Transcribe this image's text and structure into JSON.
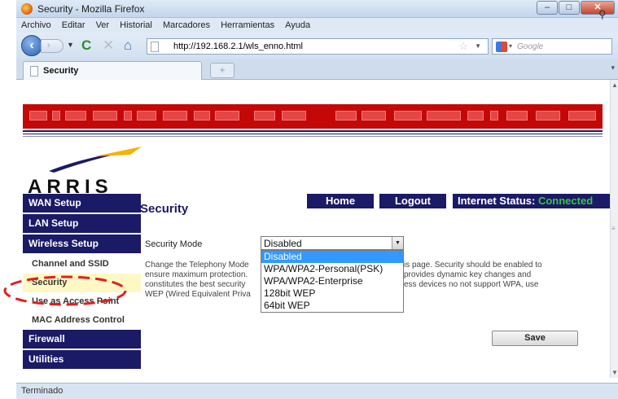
{
  "window": {
    "title": "Security - Mozilla Firefox",
    "buttons": [
      "–",
      "□",
      "✕"
    ]
  },
  "menu": [
    "Archivo",
    "Editar",
    "Ver",
    "Historial",
    "Marcadores",
    "Herramientas",
    "Ayuda"
  ],
  "toolbar": {
    "url": "http://192.168.2.1/wls_enno.html",
    "search_engine": "Google",
    "icons": [
      "back-icon",
      "forward-icon",
      "reload-icon",
      "stop-icon",
      "home-icon",
      "star-icon",
      "search-icon"
    ]
  },
  "tabs": [
    {
      "label": "Security"
    }
  ],
  "newtab_label": "+",
  "router": {
    "logo": "ARRIS",
    "top_buttons": {
      "home": "Home",
      "logout": "Logout"
    },
    "internet_status": {
      "label": "Internet Status:",
      "value": "Connected",
      "value_color": "#3ec43e"
    },
    "sidebar": [
      {
        "label": "WAN Setup",
        "type": "section"
      },
      {
        "label": "LAN Setup",
        "type": "section"
      },
      {
        "label": "Wireless Setup",
        "type": "section"
      },
      {
        "label": "Channel and SSID",
        "type": "sub"
      },
      {
        "label": "Security",
        "type": "sub",
        "active": true
      },
      {
        "label": "Use as Access Point",
        "type": "sub"
      },
      {
        "label": "MAC Address Control",
        "type": "sub"
      },
      {
        "label": "Firewall",
        "type": "section"
      },
      {
        "label": "Utilities",
        "type": "section"
      }
    ],
    "page_title": "Security",
    "security_mode": {
      "label": "Security Mode",
      "selected": "Disabled",
      "options": [
        "Disabled",
        "WPA/WPA2-Personal(PSK)",
        "WPA/WPA2-Enterprise",
        "128bit WEP",
        "64bit WEP"
      ]
    },
    "description_left": [
      "Change the Telephony Mode",
      "ensure maximum protection.",
      "constitutes the best security",
      "WEP (Wired Equivalent Priva"
    ],
    "description_right": [
      "is page. Security should be enabled to",
      "provides dynamic key changes and",
      "ess devices no not support WPA, use",
      ""
    ],
    "save_label": "Save"
  },
  "statusbar": {
    "text": "Terminado"
  },
  "colors": {
    "nav_bg": "#1a1a66",
    "banner_red": "#c40808",
    "selection": "#3399ff",
    "annotation": "#e02020"
  }
}
